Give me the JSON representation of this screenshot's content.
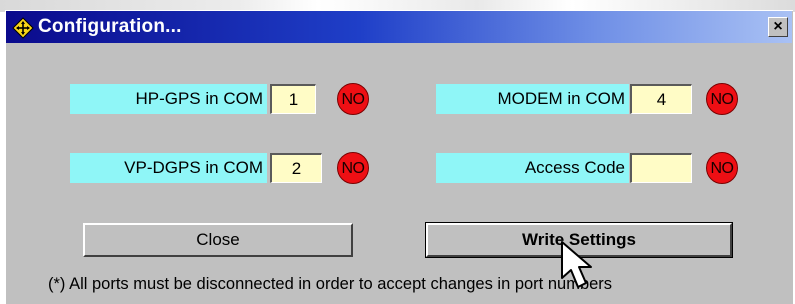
{
  "window": {
    "title": "Configuration...",
    "close_glyph": "×"
  },
  "fields": {
    "hp_gps": {
      "label": "HP-GPS in COM",
      "value": "1",
      "status": "NO"
    },
    "modem": {
      "label": "MODEM in COM",
      "value": "4",
      "status": "NO"
    },
    "vp_dgps": {
      "label": "VP-DGPS in COM",
      "value": "2",
      "status": "NO"
    },
    "access_code": {
      "label": "Access Code",
      "value": "",
      "status": "NO"
    }
  },
  "buttons": {
    "close_label": "Close",
    "write_label": "Write Settings"
  },
  "note": "(*) All ports must be disconnected in order to accept changes in port numbers",
  "colors": {
    "label_bg": "#8ff6f7",
    "field_bg": "#fffcc6",
    "status_red": "#ee0f14",
    "title_dark": "#0a0a8c",
    "title_light": "#a9c1f4"
  },
  "icons": {
    "title_icon": "yellow-diamond-crosshair-icon",
    "close_icon": "close-icon",
    "cursor": "mouse-pointer-icon"
  }
}
